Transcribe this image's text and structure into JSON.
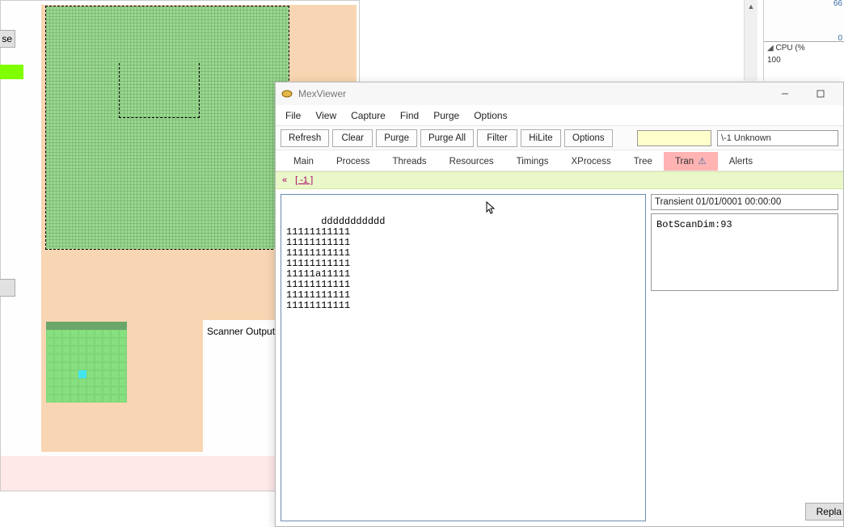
{
  "bg": {
    "btn_se": "se",
    "scanner_label": "Scanner Output:"
  },
  "cpu": {
    "val_top": "66",
    "val_bottom": "0",
    "cpu_label": "CPU (%",
    "cpu_val": "100"
  },
  "mex": {
    "title": "MexViewer",
    "menu": [
      "File",
      "View",
      "Capture",
      "Find",
      "Purge",
      "Options"
    ],
    "toolbar": [
      "Refresh",
      "Clear",
      "Purge",
      "Purge All",
      "Filter",
      "HiLite",
      "Options"
    ],
    "combo_val": "\\-1   Unknown",
    "tabs": [
      "Main",
      "Process",
      "Threads",
      "Resources",
      "Timings",
      "XProcess",
      "Tree",
      "Tran",
      "Alerts"
    ],
    "subbar_back": "«",
    "subbar_tag": "[ -1 ]",
    "left_lines": "ddddddddddd\n11111111111\n11111111111\n11111111111\n11111111111\n11111a11111\n11111111111\n11111111111\n11111111111",
    "trans_header": "Transient 01/01/0001 00:00:00",
    "trans_body": "BotScanDim:93",
    "replace_btn": "Repla"
  },
  "chart_data": {
    "type": "line",
    "title": "CPU (%)",
    "ylim": [
      0,
      66
    ],
    "series": [
      {
        "name": "cpu",
        "values": []
      }
    ],
    "current": 100
  }
}
